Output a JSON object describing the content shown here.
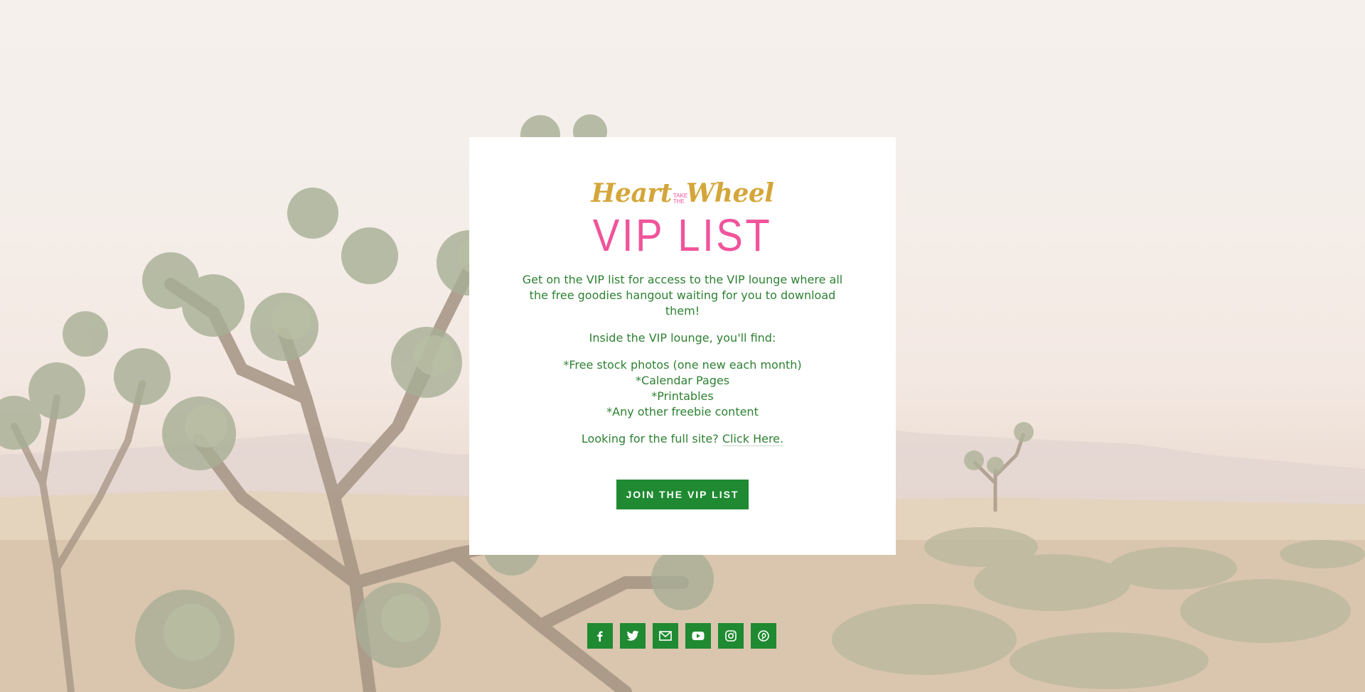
{
  "brand": {
    "logo_left": "Heart",
    "logo_small": "TAKE THE",
    "logo_right": "Wheel",
    "title": "VIP LIST"
  },
  "content": {
    "intro": "Get on the VIP list for access to the VIP lounge where all the free goodies hangout waiting for you to download them!",
    "inside": "Inside the VIP lounge, you'll find:",
    "items": [
      "*Free stock photos (one new each month)",
      "*Calendar Pages",
      "*Printables",
      "*Any other freebie content"
    ],
    "full_site_prefix": "Looking for the full site?",
    "full_site_link": "Click Here."
  },
  "cta": {
    "join_label": "JOIN THE VIP LIST"
  },
  "social": [
    {
      "name": "facebook-icon"
    },
    {
      "name": "twitter-icon"
    },
    {
      "name": "email-icon"
    },
    {
      "name": "youtube-icon"
    },
    {
      "name": "instagram-icon"
    },
    {
      "name": "pinterest-icon"
    }
  ],
  "colors": {
    "pink": "#f0549b",
    "gold": "#d4a63a",
    "green": "#1f8a31",
    "text_green": "#2e8133"
  }
}
